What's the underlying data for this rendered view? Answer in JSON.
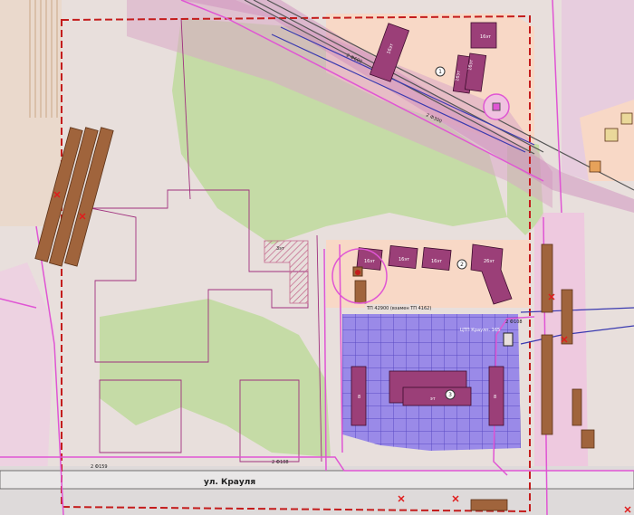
{
  "map": {
    "street_name": "ул. Крауля",
    "substation_label": "ТП 42900 (взамен ТП 4162)",
    "heating_point_label": "ЦТП Краулп. 165",
    "pipe_labels": [
      "2 Ф600",
      "2 Ф300",
      "2 Ф108",
      "2 Ф159",
      "2 Ф108"
    ],
    "building_labels": [
      "16эт",
      "16эт",
      "16эт",
      "16эт",
      "16эт",
      "16эт",
      "16эт",
      "26эт",
      "эт",
      "8",
      "8",
      "3эт"
    ],
    "zone_labels": [
      "1",
      "2",
      "3"
    ],
    "colors": {
      "territory": "#e8dfdc",
      "green": "#c5dba6",
      "residential_zone": "#f8d8c6",
      "school_zone": "#9a8ae8",
      "building": "#9b3f78",
      "engineering": "#e055d4",
      "gas_pipe": "#3a3ab0",
      "border": "#c41c1c",
      "brown_building": "#a0643c"
    }
  }
}
